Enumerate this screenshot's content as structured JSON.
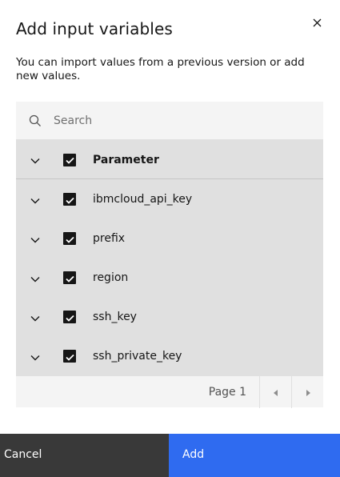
{
  "modal": {
    "title": "Add input variables",
    "description": "You can import values from a previous version or add new values.",
    "close_icon": "close-icon"
  },
  "search": {
    "placeholder": "Search",
    "value": ""
  },
  "table": {
    "header": {
      "label": "Parameter",
      "checked": true
    },
    "rows": [
      {
        "label": "ibmcloud_api_key",
        "checked": true
      },
      {
        "label": "prefix",
        "checked": true
      },
      {
        "label": "region",
        "checked": true
      },
      {
        "label": "ssh_key",
        "checked": true
      },
      {
        "label": "ssh_private_key",
        "checked": true
      }
    ]
  },
  "pagination": {
    "page_label": "Page 1",
    "prev_icon": "caret-left-icon",
    "next_icon": "caret-right-icon"
  },
  "footer": {
    "cancel_label": "Cancel",
    "add_label": "Add"
  },
  "colors": {
    "primary": "#2f6bf0",
    "secondary": "#393939",
    "row_bg": "#e0e0e0",
    "search_bg": "#f4f4f4",
    "checkbox": "#161616"
  }
}
